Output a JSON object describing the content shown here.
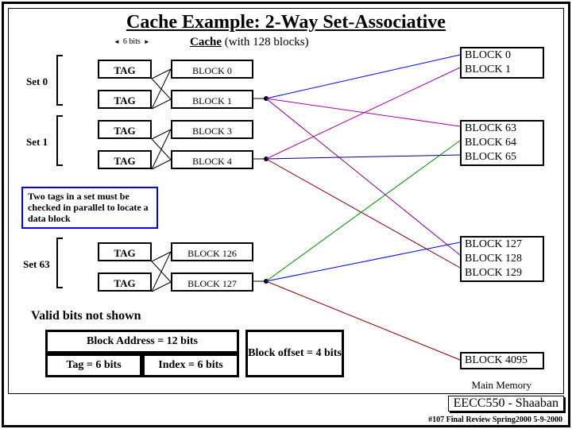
{
  "title": "Cache Example: 2-Way Set-Associative",
  "bits_marker": "6 bits",
  "cache_header_bold": "Cache",
  "cache_header_rest": " (with 128 blocks)",
  "sets": {
    "s0": "Set 0",
    "s1": "Set 1",
    "s63": "Set 63"
  },
  "tag_label": "TAG",
  "cache_blocks": {
    "b0": "BLOCK 0",
    "b1": "BLOCK 1",
    "b3": "BLOCK 3",
    "b4": "BLOCK 4",
    "b126": "BLOCK 126",
    "b127": "BLOCK 127"
  },
  "note": "Two tags in a set must be checked in parallel to locate a data block",
  "valid_note": "Valid bits not shown",
  "memory": {
    "group1": [
      "BLOCK 0",
      "BLOCK 1"
    ],
    "group2": [
      "BLOCK 63",
      "BLOCK 64",
      "BLOCK 65"
    ],
    "group3": [
      "BLOCK 127",
      "BLOCK 128",
      "BLOCK 129"
    ],
    "last": "BLOCK 4095",
    "label": "Main Memory"
  },
  "address": {
    "block_addr": "Block Address  =  12 bits",
    "tag": "Tag  =  6 bits",
    "index": "Index  =  6 bits",
    "offset": "Block offset =  4 bits"
  },
  "footer": {
    "badge": "EECC550 - Shaaban",
    "line": "#107   Final Review   Spring2000   5-9-2000"
  }
}
